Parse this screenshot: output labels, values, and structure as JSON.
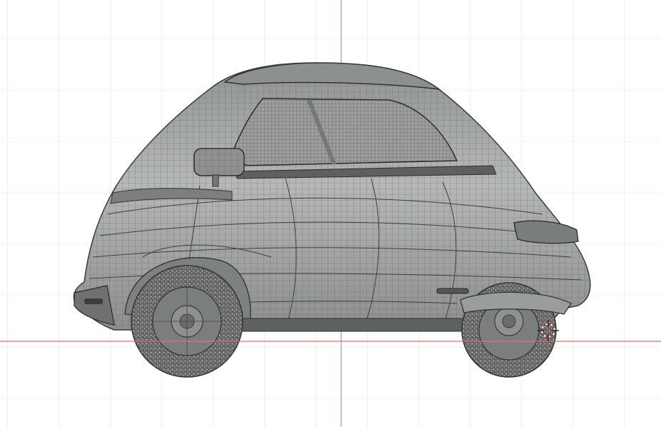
{
  "viewport": {
    "view": "side-orthographic",
    "mode": "wireframe-overlay",
    "object": "microcar",
    "colors": {
      "background": "#ffffff",
      "grid": "#e4e4e4",
      "axis_x": "#e07070",
      "axis_z": "#7f9fd8",
      "body_fill": "#a9acac",
      "wire": "#4a4a4a",
      "tire": "#6e6e6e",
      "cursor": "#cc2020"
    },
    "icons": {
      "cursor": "3d-cursor-icon"
    }
  }
}
